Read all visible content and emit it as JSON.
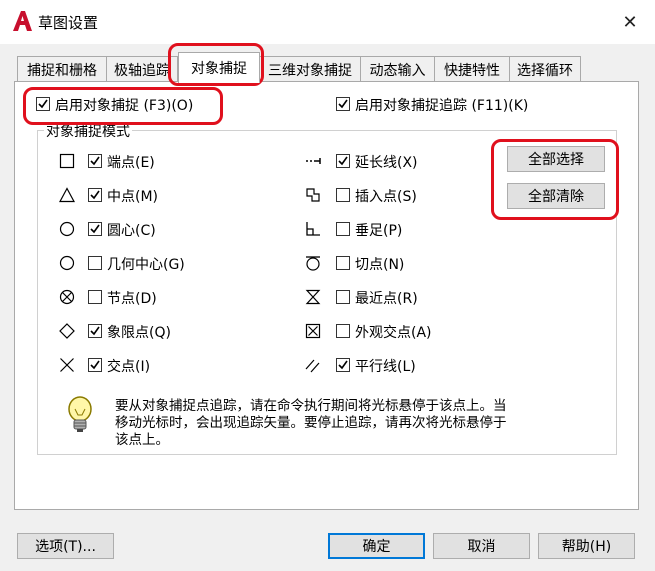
{
  "window": {
    "title": "草图设置",
    "close_symbol": "✕"
  },
  "tabs": [
    {
      "label": "捕捉和栅格",
      "active": false
    },
    {
      "label": "极轴追踪",
      "active": false
    },
    {
      "label": "对象捕捉",
      "active": true
    },
    {
      "label": "三维对象捕捉",
      "active": false
    },
    {
      "label": "动态输入",
      "active": false
    },
    {
      "label": "快捷特性",
      "active": false
    },
    {
      "label": "选择循环",
      "active": false
    }
  ],
  "top_options": {
    "osnap_on": {
      "label": "启用对象捕捉 (F3)(O)",
      "checked": true
    },
    "osnap_track": {
      "label": "启用对象捕捉追踪 (F11)(K)",
      "checked": true
    }
  },
  "group": {
    "label": "对象捕捉模式",
    "left": [
      {
        "label": "端点(E)",
        "checked": true,
        "icon": "endpoint-square-icon"
      },
      {
        "label": "中点(M)",
        "checked": true,
        "icon": "midpoint-triangle-icon"
      },
      {
        "label": "圆心(C)",
        "checked": true,
        "icon": "center-circle-icon"
      },
      {
        "label": "几何中心(G)",
        "checked": false,
        "icon": "geometric-center-icon"
      },
      {
        "label": "节点(D)",
        "checked": false,
        "icon": "node-icon"
      },
      {
        "label": "象限点(Q)",
        "checked": true,
        "icon": "quadrant-diamond-icon"
      },
      {
        "label": "交点(I)",
        "checked": true,
        "icon": "intersection-x-icon"
      }
    ],
    "right": [
      {
        "label": "延长线(X)",
        "checked": true,
        "icon": "extension-icon"
      },
      {
        "label": "插入点(S)",
        "checked": false,
        "icon": "insertion-icon"
      },
      {
        "label": "垂足(P)",
        "checked": false,
        "icon": "perpendicular-icon"
      },
      {
        "label": "切点(N)",
        "checked": false,
        "icon": "tangent-icon"
      },
      {
        "label": "最近点(R)",
        "checked": false,
        "icon": "nearest-hourglass-icon"
      },
      {
        "label": "外观交点(A)",
        "checked": false,
        "icon": "apparent-intersection-icon"
      },
      {
        "label": "平行线(L)",
        "checked": true,
        "icon": "parallel-icon"
      }
    ],
    "select_all": "全部选择",
    "clear_all": "全部清除"
  },
  "hint": {
    "line1": "要从对象捕捉点追踪，请在命令执行期间将光标悬停于该点上。当",
    "line2": "移动光标时，会出现追踪矢量。要停止追踪，请再次将光标悬停于",
    "line3": "该点上。"
  },
  "footer": {
    "options": "选项(T)...",
    "ok": "确定",
    "cancel": "取消",
    "help": "帮助(H)"
  },
  "colors": {
    "highlight_red": "#e0101d",
    "accent_blue": "#0078d7",
    "autocad_red": "#c8102e"
  }
}
